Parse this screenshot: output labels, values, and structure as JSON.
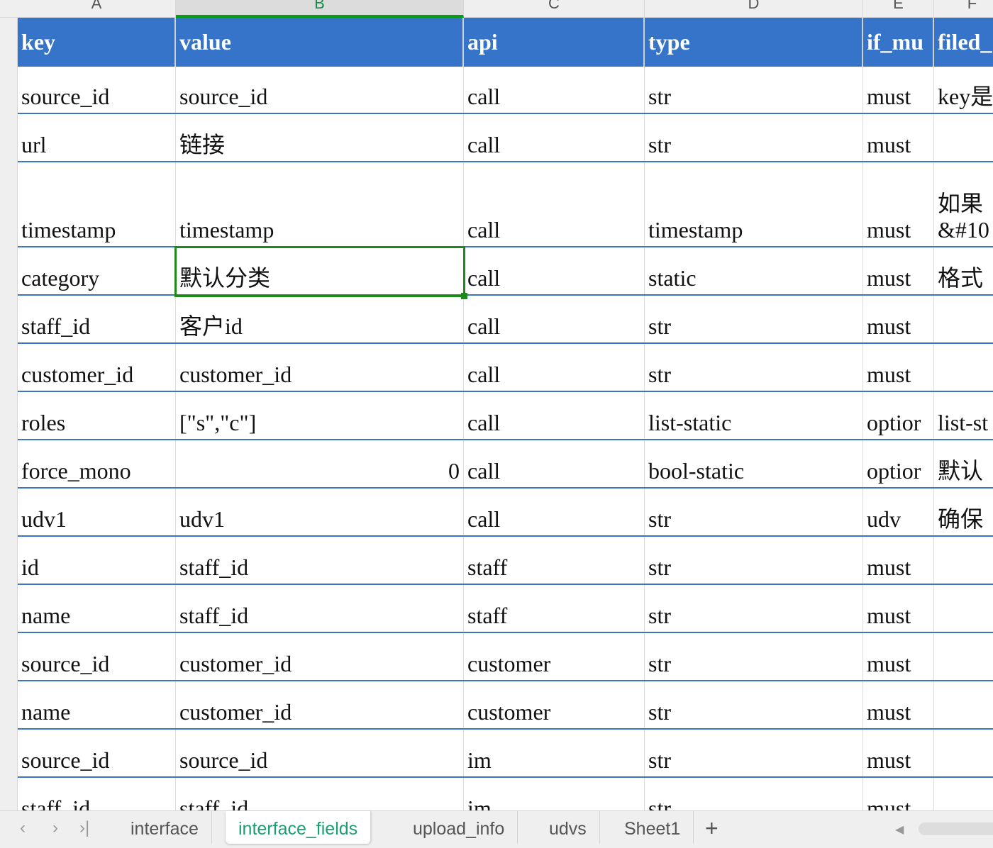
{
  "columns": [
    "A",
    "B",
    "C",
    "D",
    "E",
    "F"
  ],
  "selected_column": "B",
  "table": {
    "headers": [
      "key",
      "value",
      "api",
      "type",
      "if_mu",
      "filed_"
    ],
    "rows": [
      [
        "source_id",
        "source_id",
        "call",
        "str",
        "must",
        "key是"
      ],
      [
        "url",
        "链接",
        "call",
        "str",
        "must",
        ""
      ],
      [
        "timestamp",
        "timestamp",
        "call",
        "timestamp",
        "must",
        "如果\n&#10"
      ],
      [
        "category",
        "默认分类",
        "call",
        "static",
        "must",
        "格式"
      ],
      [
        "staff_id",
        "客户id",
        "call",
        "str",
        "must",
        ""
      ],
      [
        "customer_id",
        "customer_id",
        "call",
        "str",
        "must",
        ""
      ],
      [
        "roles",
        "[\"s\",\"c\"]",
        "call",
        "list-static",
        "optior",
        "list-st"
      ],
      [
        "force_mono",
        "0",
        "call",
        "bool-static",
        "optior",
        "默认"
      ],
      [
        "udv1",
        "udv1",
        "call",
        "str",
        "udv",
        "确保"
      ],
      [
        "id",
        "staff_id",
        "staff",
        "str",
        "must",
        ""
      ],
      [
        "name",
        "staff_id",
        "staff",
        "str",
        "must",
        ""
      ],
      [
        "source_id",
        "customer_id",
        "customer",
        "str",
        "must",
        ""
      ],
      [
        "name",
        "customer_id",
        "customer",
        "str",
        "must",
        ""
      ],
      [
        "source_id",
        "source_id",
        "im",
        "str",
        "must",
        ""
      ],
      [
        "staff_id",
        "staff_id",
        "im",
        "str",
        "must",
        ""
      ]
    ]
  },
  "selected_cell": "B5",
  "sheet_tabs": [
    {
      "label": "interface",
      "active": false
    },
    {
      "label": "interface_fields",
      "active": true
    },
    {
      "label": "upload_info",
      "active": false
    },
    {
      "label": "udvs",
      "active": false
    },
    {
      "label": "Sheet1",
      "active": false
    }
  ],
  "add_sheet_label": "+",
  "colors": {
    "header_bg": "#3574c8",
    "selection": "#1a8a1a",
    "active_tab": "#1aa070"
  }
}
